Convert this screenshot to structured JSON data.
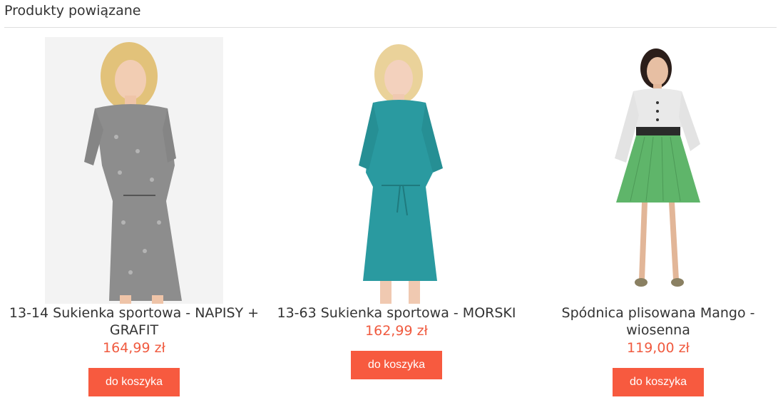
{
  "section": {
    "title": "Produkty powiązane"
  },
  "products": [
    {
      "name": "13-14 Sukienka sportowa - NAPISY + GRAFIT",
      "price": "164,99 zł",
      "button": "do koszyka",
      "color": "#8d8d8d"
    },
    {
      "name": "13-63 Sukienka sportowa - MORSKI",
      "price": "162,99 zł",
      "button": "do koszyka",
      "color": "#2a9aa0"
    },
    {
      "name": "Spódnica plisowana Mango - wiosenna",
      "price": "119,00 zł",
      "button": "do koszyka",
      "color": "#5fb56a"
    }
  ],
  "colors": {
    "accent": "#f75a3f",
    "price": "#f05a3f",
    "text": "#333333"
  }
}
